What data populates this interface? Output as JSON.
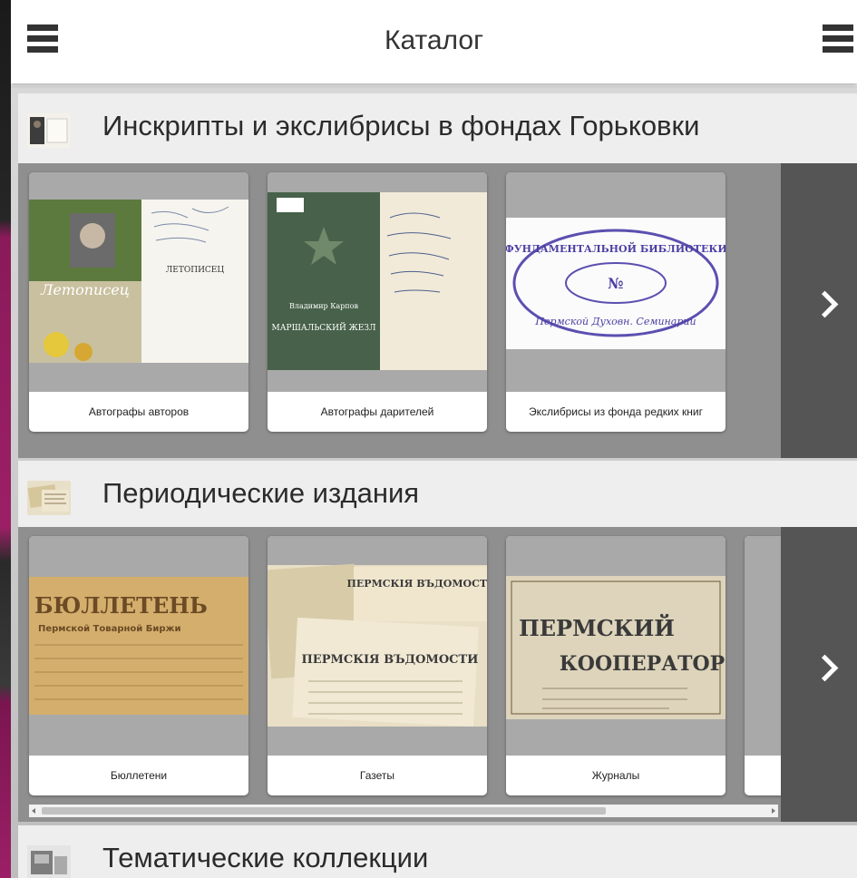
{
  "header": {
    "title": "Каталог",
    "left_icon": "hamburger-menu-icon",
    "right_icon": "hamburger-menu-icon"
  },
  "sections": [
    {
      "title": "Инскрипты и экслибрисы в фондах Горьковки",
      "thumb_icon": "inscription-thumb",
      "cards": [
        {
          "caption": "Автографы авторов",
          "image_text": "Летописец",
          "image_subtext": "ЛЕТОПИСЕЦ"
        },
        {
          "caption": "Автографы дарителей",
          "image_text": "Владимир Карпов",
          "image_subtext": "МАРШАЛЬСКИЙ ЖЕЗЛ"
        },
        {
          "caption": "Экслибрисы из фонда редких книг",
          "image_text": "ФУНДАМЕНТАЛЬНОЙ БИБЛИОТЕКИ",
          "image_subtext": "Пермской Духовн. Семинарии"
        }
      ]
    },
    {
      "title": "Периодические издания",
      "thumb_icon": "newspaper-thumb",
      "cards": [
        {
          "caption": "Бюллетени",
          "image_text": "БЮЛЛЕТЕНЬ",
          "image_subtext": "Пермской Товарной Биржи"
        },
        {
          "caption": "Газеты",
          "image_text": "ПЕРМСКІЯ ВЪДОМОСТИ",
          "image_subtext": "ПЕРМСКІЯ ВЪДОМОСТИ"
        },
        {
          "caption": "Журналы",
          "image_text": "ПЕРМСКИЙ",
          "image_subtext": "КООПЕРАТОР"
        }
      ]
    },
    {
      "title": "Тематические коллекции",
      "thumb_icon": "collection-thumb"
    }
  ],
  "scrollbar": {
    "position": 0.0,
    "visible_fraction": 0.78
  },
  "colors": {
    "accent_bg": "#ececec",
    "strip_bg": "#8f8f8f",
    "nav_bg": "#555555"
  }
}
